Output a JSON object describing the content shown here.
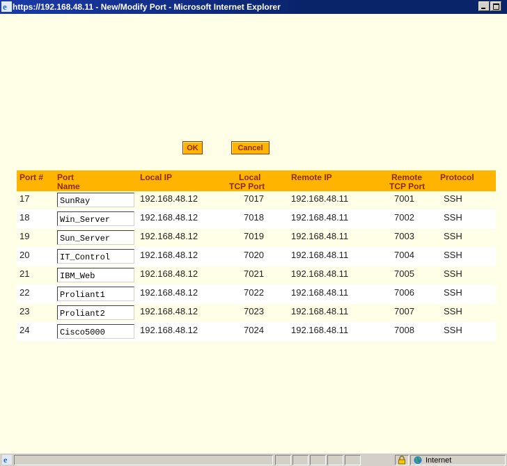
{
  "window": {
    "title": "https://192.168.48.11 - New/Modify Port - Microsoft Internet Explorer"
  },
  "buttons": {
    "ok": "OK",
    "cancel": "Cancel"
  },
  "table": {
    "headers": {
      "port": "Port #",
      "name_line1": "Port",
      "name_line2": "Name",
      "local_ip": "Local IP",
      "local_tcp_line1": "Local",
      "local_tcp_line2": "TCP Port",
      "remote_ip": "Remote IP",
      "remote_tcp_line1": "Remote",
      "remote_tcp_line2": "TCP Port",
      "protocol": "Protocol"
    },
    "rows": [
      {
        "port": "17",
        "name": "SunRay",
        "local_ip": "192.168.48.12",
        "local_tcp": "7017",
        "remote_ip": "192.168.48.11",
        "remote_tcp": "7001",
        "protocol": "SSH"
      },
      {
        "port": "18",
        "name": "Win_Server",
        "local_ip": "192.168.48.12",
        "local_tcp": "7018",
        "remote_ip": "192.168.48.11",
        "remote_tcp": "7002",
        "protocol": "SSH"
      },
      {
        "port": "19",
        "name": "Sun_Server",
        "local_ip": "192.168.48.12",
        "local_tcp": "7019",
        "remote_ip": "192.168.48.11",
        "remote_tcp": "7003",
        "protocol": "SSH"
      },
      {
        "port": "20",
        "name": "IT_Control",
        "local_ip": "192.168.48.12",
        "local_tcp": "7020",
        "remote_ip": "192.168.48.11",
        "remote_tcp": "7004",
        "protocol": "SSH"
      },
      {
        "port": "21",
        "name": "IBM_Web",
        "local_ip": "192.168.48.12",
        "local_tcp": "7021",
        "remote_ip": "192.168.48.11",
        "remote_tcp": "7005",
        "protocol": "SSH"
      },
      {
        "port": "22",
        "name": "Proliant1",
        "local_ip": "192.168.48.12",
        "local_tcp": "7022",
        "remote_ip": "192.168.48.11",
        "remote_tcp": "7006",
        "protocol": "SSH"
      },
      {
        "port": "23",
        "name": "Proliant2",
        "local_ip": "192.168.48.12",
        "local_tcp": "7023",
        "remote_ip": "192.168.48.11",
        "remote_tcp": "7007",
        "protocol": "SSH"
      },
      {
        "port": "24",
        "name": "Cisco5000",
        "local_ip": "192.168.48.12",
        "local_tcp": "7024",
        "remote_ip": "192.168.48.11",
        "remote_tcp": "7008",
        "protocol": "SSH"
      }
    ]
  },
  "statusbar": {
    "zone": "Internet"
  },
  "colors": {
    "accent": "#ffb400",
    "header_text": "#8a2a00",
    "background": "#ffffe8",
    "titlebar": "#0a246a"
  },
  "icons": [
    "ie-icon",
    "minimize-icon",
    "maximize-icon",
    "lock-icon",
    "globe-icon"
  ]
}
